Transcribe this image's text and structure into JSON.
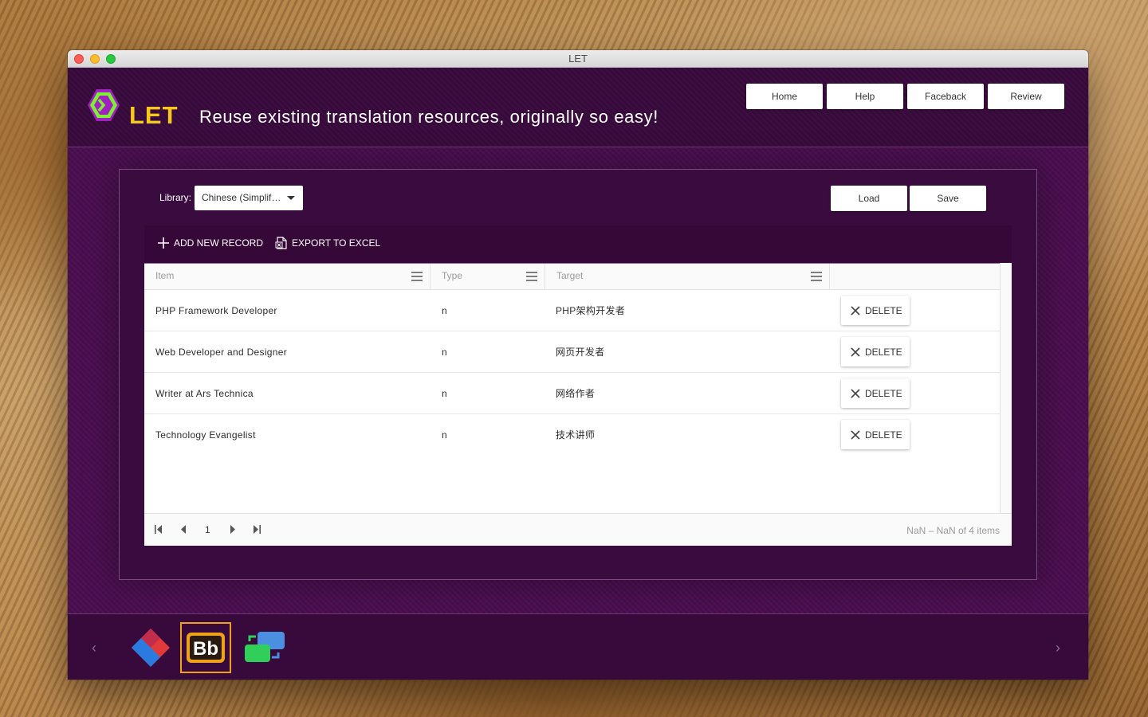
{
  "window": {
    "title": "LET"
  },
  "header": {
    "logo_text": "LET",
    "tagline": "Reuse existing translation resources, originally so easy!",
    "nav": [
      "Home",
      "Help",
      "Faceback",
      "Review"
    ]
  },
  "panel": {
    "library_label": "Library:",
    "library_value": "Chinese (Simplified)",
    "load_label": "Load",
    "save_label": "Save"
  },
  "toolbar": {
    "add_label": "ADD NEW RECORD",
    "export_label": "EXPORT TO EXCEL"
  },
  "grid": {
    "columns": [
      "Item",
      "Type",
      "Target",
      ""
    ],
    "rows": [
      {
        "item": "PHP Framework Developer",
        "type": "n",
        "target": "PHP架构开发者",
        "action": "DELETE"
      },
      {
        "item": "Web Developer and Designer",
        "type": "n",
        "target": "网页开发者",
        "action": "DELETE"
      },
      {
        "item": "Writer at Ars Technica",
        "type": "n",
        "target": "网络作者",
        "action": "DELETE"
      },
      {
        "item": "Technology Evangelist",
        "type": "n",
        "target": "技术讲师",
        "action": "DELETE"
      }
    ]
  },
  "pager": {
    "page": "1",
    "info": "NaN – NaN of 4 items"
  },
  "bottom_bar": {
    "apps": [
      "diamond-app-icon",
      "bb-app-icon",
      "translate-app-icon"
    ],
    "selected_app": "bb-app-icon",
    "bb_text": "Bb",
    "prev": "‹",
    "next": "›"
  },
  "colors": {
    "accent_yellow": "#f6c81c",
    "header_bg": "#370a3b",
    "panel_bg": "#3a0b3f",
    "selected_border": "#f0a11a"
  }
}
